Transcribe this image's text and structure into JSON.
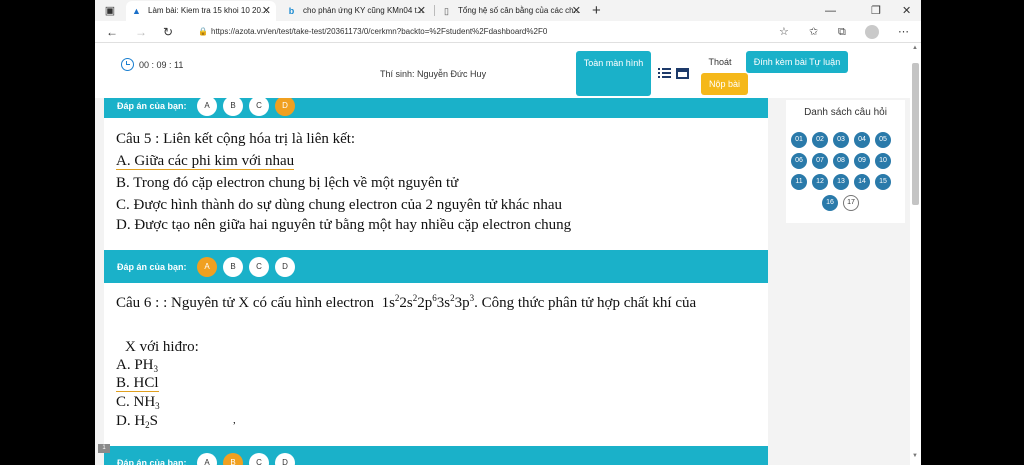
{
  "browser": {
    "tabs": [
      {
        "title": "Làm bài: Kiem tra 15 khoi 10 20...",
        "icon": "azota-icon"
      },
      {
        "title": "cho phản ứng KY cũng KMn04 t...",
        "icon": "bing-icon"
      },
      {
        "title": "Tổng hệ số cân bằng của các ch...",
        "icon": "page-icon"
      }
    ],
    "url": "https://azota.vn/en/test/take-test/20361173/0/cerkmn?backto=%2Fstudent%2Fdashboard%2F0"
  },
  "header": {
    "timer": "00 : 09 : 11",
    "student": "Thí sinh: Nguyễn Đức Huy",
    "fullscreen_label": "Toàn màn hình",
    "exit_label": "Thoát",
    "attach_label": "Đính kèm bài Tự luận",
    "submit_label": "Nộp bài"
  },
  "answer_label": "Đáp án của bạn:",
  "answers": [
    {
      "options": [
        "A",
        "B",
        "C",
        "D"
      ],
      "selected": "D"
    },
    {
      "options": [
        "A",
        "B",
        "C",
        "D"
      ],
      "selected": "A"
    },
    {
      "options": [
        "A",
        "B",
        "C",
        "D"
      ],
      "selected": "B"
    }
  ],
  "q5": {
    "title": "Câu 5 :   Liên kết cộng hóa trị là liên kết:",
    "a": "A. Giữa các phi kim với nhau",
    "b": "B. Trong đó cặp electron chung bị lệch về một nguyên tử",
    "c": "C. Được hình thành do sự dùng chung electron của 2 nguyên  tử khác nhau",
    "d": "D. Được tạo nên giữa hai nguyên tử bằng một hay nhiều  cặp electron chung"
  },
  "q6": {
    "title": "Câu 6 : : Nguyên tử X có cấu hình electron  1s²2s²2p⁶3s²3p³. Công thức phân tử  hợp chất khí của",
    "title_prefix": "Câu 6 : : Nguyên tử X có cấu hình electron",
    "title_suffix": ". Công thức phân tử  hợp chất khí của",
    "config": [
      {
        "t": "1s",
        "sup": "2"
      },
      {
        "t": "2s",
        "sup": "2"
      },
      {
        "t": "2p",
        "sup": "6"
      },
      {
        "t": "3s",
        "sup": "2"
      },
      {
        "t": "3p",
        "sup": "3"
      }
    ],
    "line2": "X với hiđro:",
    "a": "A. PH₃",
    "b": "B. HCl",
    "c": "C. NH₃",
    "d": "D. H₂S",
    "a_label": "A. PH",
    "a_sub": "3",
    "b_label": "B. HCl",
    "c_label": "C. NH",
    "c_sub": "3",
    "d_label": "D. H",
    "d_sub": "2",
    "d_tail": "S",
    "stray_mark": ","
  },
  "sidebar": {
    "title": "Danh sách câu hỏi",
    "questions": [
      "01",
      "02",
      "03",
      "04",
      "05",
      "06",
      "07",
      "08",
      "09",
      "10",
      "11",
      "12",
      "13",
      "14",
      "15",
      "16",
      "17"
    ],
    "unanswered": "17"
  },
  "corner_tab": "1"
}
